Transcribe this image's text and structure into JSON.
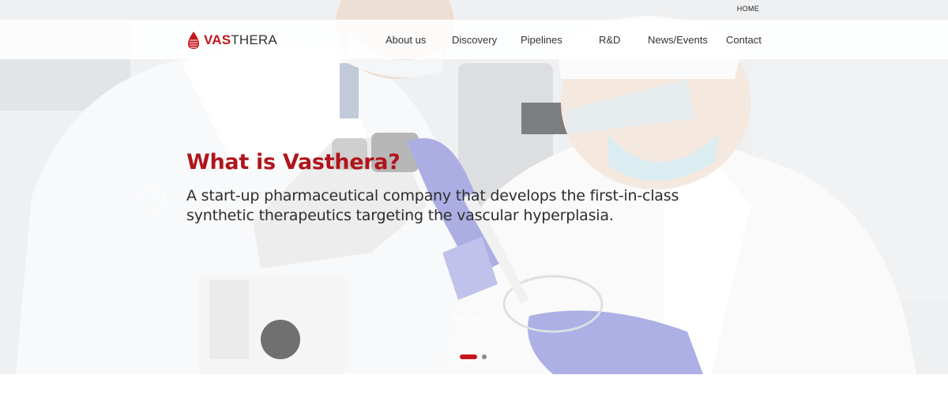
{
  "utility": {
    "home_label": "HOME"
  },
  "brand": {
    "logo_part1": "VAS",
    "logo_part2": "THERA",
    "color": "#c4161c"
  },
  "nav": {
    "items": [
      {
        "label": "About us"
      },
      {
        "label": "Discovery"
      },
      {
        "label": "Pipelines"
      },
      {
        "label": "R&D"
      },
      {
        "label": "News/Events"
      },
      {
        "label": "Contact"
      }
    ]
  },
  "hero": {
    "title": "What is Vasthera?",
    "subtitle_line1": "A start-up pharmaceutical company that develops the first-in-class",
    "subtitle_line2": "synthetic therapeutics targeting the vascular hyperplasia.",
    "scroll_label": "Scroll Down",
    "slides": {
      "count": 2,
      "active": 1
    },
    "accent_color": "#b1151c"
  }
}
